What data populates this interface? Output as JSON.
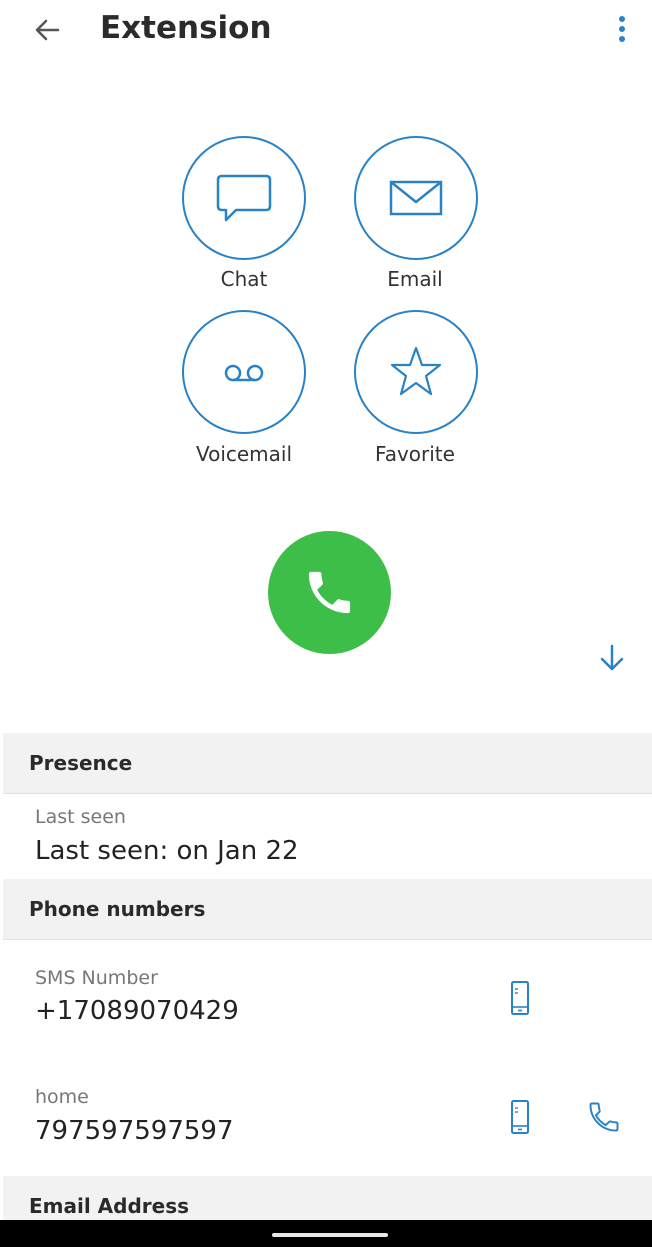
{
  "header": {
    "title": "Extension",
    "back_icon": "arrow-left-icon",
    "menu_icon": "more-vertical-icon"
  },
  "actions": [
    {
      "label": "Chat",
      "icon": "chat-bubble-icon"
    },
    {
      "label": "Email",
      "icon": "envelope-icon"
    },
    {
      "label": "Voicemail",
      "icon": "voicemail-icon"
    },
    {
      "label": "Favorite",
      "icon": "star-icon"
    }
  ],
  "call": {
    "icon": "phone-icon",
    "color": "#3dbe48"
  },
  "scroll_icon": "arrow-down-icon",
  "presence": {
    "heading": "Presence",
    "label": "Last seen",
    "value": "Last seen: on Jan 22"
  },
  "phone_numbers": {
    "heading": "Phone numbers",
    "items": [
      {
        "label": "SMS Number",
        "number": "+17089070429"
      },
      {
        "label": "home",
        "number": "797597597597"
      }
    ]
  },
  "email": {
    "heading": "Email Address"
  },
  "colors": {
    "accent": "#2a82c6",
    "call_green": "#3dbe48",
    "section_bg": "#f2f2f2"
  }
}
